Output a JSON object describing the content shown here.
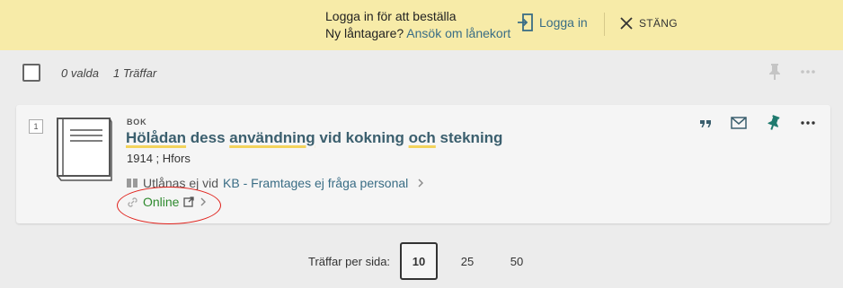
{
  "banner": {
    "line1": "Logga in för att beställa",
    "line2_prefix": "Ny låntagare?",
    "line2_link": "Ansök om lånekort",
    "login_label": "Logga in",
    "close_label": "STÄNG",
    "background_color": "#f7eba8"
  },
  "toolbar": {
    "selected_count": "0 valda",
    "hits": "1 Träffar"
  },
  "result": {
    "index": "1",
    "type": "BOK",
    "title_parts": [
      "Hölådan",
      " dess ",
      "användning",
      " vid kokning ",
      "och",
      " stekning"
    ],
    "pubinfo": "1914 ; Hfors",
    "availability_status": "Utlånas ej vid",
    "availability_location": "KB - Framtages ej fråga personal",
    "online_label": "Online",
    "accent_online": "#2e8a2e",
    "title_color": "#3b5f6e"
  },
  "pagination": {
    "label": "Träffar per sida:",
    "options": [
      "10",
      "25",
      "50"
    ],
    "selected": "10"
  },
  "icons": [
    "login-icon",
    "close-icon",
    "pin-icon",
    "more-icon",
    "quote-icon",
    "email-icon",
    "book-icon",
    "link-icon",
    "external-link-icon",
    "chevron-right-icon"
  ]
}
